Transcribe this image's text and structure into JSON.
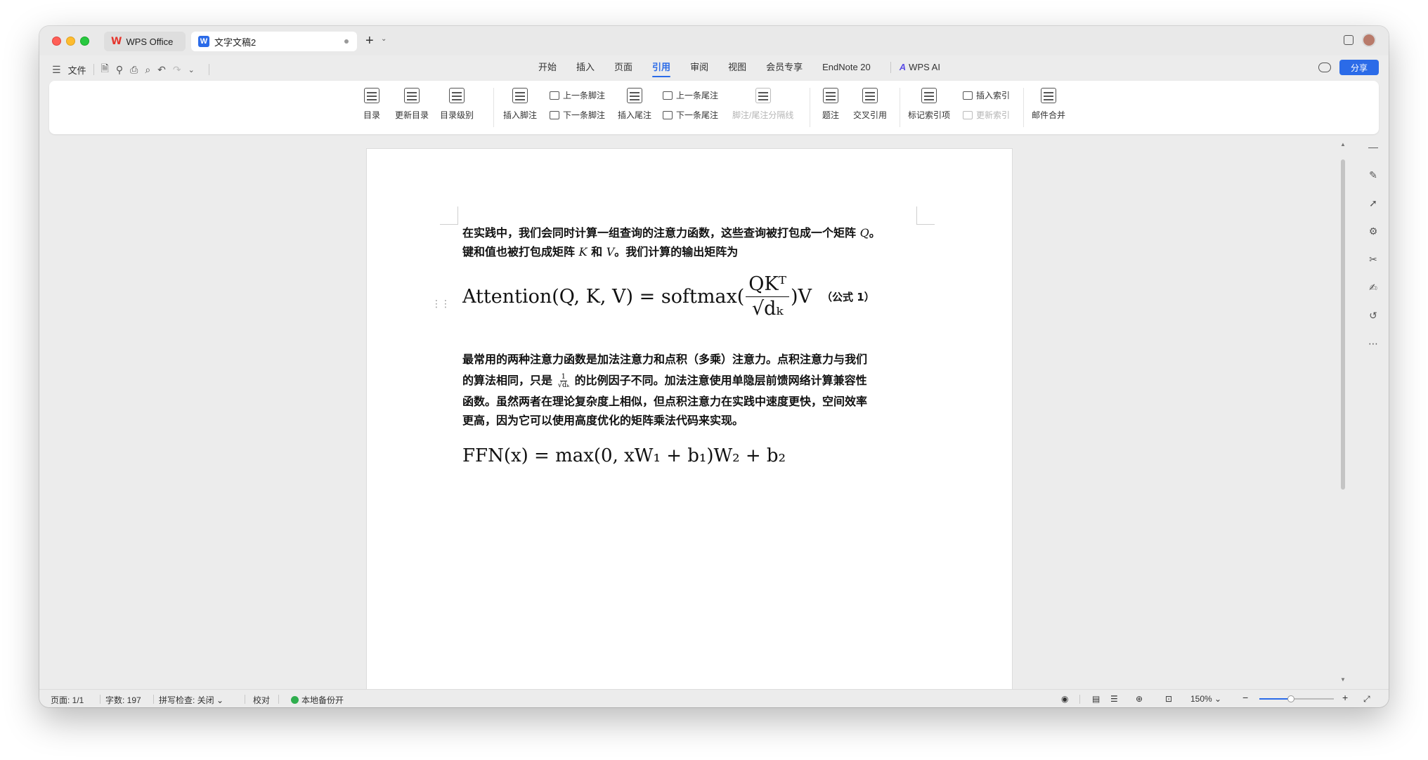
{
  "tabs": {
    "app_label": "WPS Office",
    "doc_label": "文字文稿2"
  },
  "menubar": {
    "file_label": "文件",
    "tabs": [
      "开始",
      "插入",
      "页面",
      "引用",
      "审阅",
      "视图",
      "会员专享",
      "EndNote 20"
    ],
    "active_tab": "引用",
    "wps_ai_label": "WPS AI",
    "share_label": "分享"
  },
  "ribbon": {
    "toc_label": "目录",
    "update_toc_label": "更新目录",
    "toc_level_label": "目录级别",
    "insert_footnote_label": "插入脚注",
    "prev_footnote_label": "上一条脚注",
    "next_footnote_label": "下一条脚注",
    "insert_endnote_label": "插入尾注",
    "prev_endnote_label": "上一条尾注",
    "next_endnote_label": "下一条尾注",
    "separator_label": "脚注/尾注分隔线",
    "caption_label": "题注",
    "cross_ref_label": "交叉引用",
    "mark_index_label": "标记索引项",
    "insert_index_label": "插入索引",
    "update_index_label": "更新索引",
    "mail_merge_label": "邮件合并"
  },
  "document": {
    "para1_line1": "在实践中，我们会同时计算一组查询的注意力函数，这些查询被打包成一个矩阵",
    "para1_q": "Q",
    "para1_line2_a": "键和值也被打包成矩阵",
    "para1_k": "K",
    "para1_and": "和",
    "para1_v": "V",
    "para1_line2_b": "。我们计算的输出矩阵为",
    "eq1_lhs": "Attention(Q, K, V) = softmax(",
    "eq1_num": "QKᵀ",
    "eq1_den": "√dₖ",
    "eq1_rhs": ")V",
    "eq1_label": "（公式 1）",
    "para2_line1": "最常用的两种注意力函数是加法注意力和点积（多乘）注意力。点积注意力与我们",
    "para2_line2_a": "的算法相同，只是",
    "para2_frac_num": "1",
    "para2_frac_den": "√dₖ",
    "para2_line2_b": "的比例因子不同。加法注意使用单隐层前馈网络计算兼容性",
    "para2_line3": "函数。虽然两者在理论复杂度上相似，但点积注意力在实践中速度更快，空间效率",
    "para2_line4": "更高，因为它可以使用高度优化的矩阵乘法代码来实现。",
    "eq2": "FFN(x) = max(0, xW₁ + b₁)W₂ + b₂"
  },
  "status": {
    "page": "页面: 1/1",
    "word_count": "字数: 197",
    "spell_check": "拼写检查: 关闭",
    "proofread": "校对",
    "backup": "本地备份开",
    "zoom": "150%",
    "zoom_fraction": 0.42
  },
  "colors": {
    "accent": "#2b6be8",
    "wps_red": "#e5352c",
    "backup_green": "#2fae4e"
  }
}
